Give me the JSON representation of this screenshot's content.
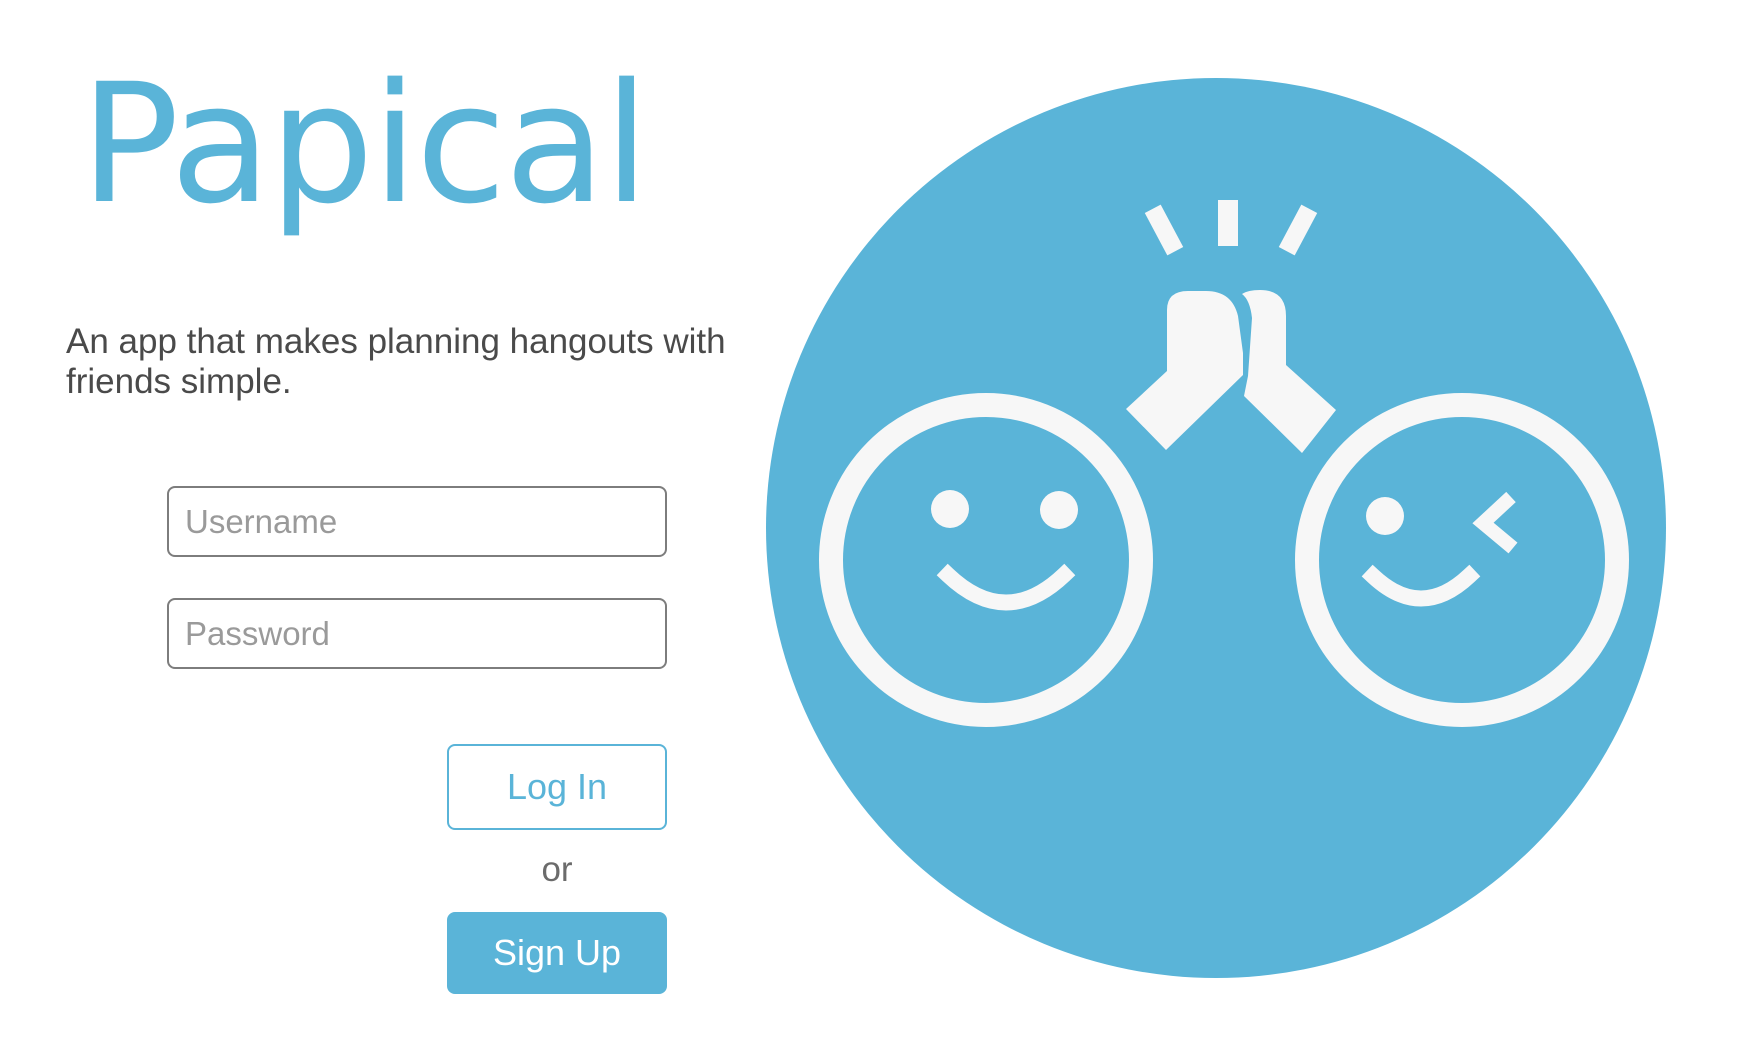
{
  "app": {
    "name": "Papical",
    "tagline": "An app that makes planning hangouts with friends simple."
  },
  "login_form": {
    "username_placeholder": "Username",
    "password_placeholder": "Password",
    "login_label": "Log In",
    "separator": "or",
    "signup_label": "Sign Up"
  },
  "logo": {
    "icon": "high-five-smiley-faces-icon",
    "background_color": "#5ab4d8",
    "foreground_color": "#f7f7f7"
  },
  "colors": {
    "brand": "#5ab4d8",
    "text": "#4a4a4a"
  }
}
